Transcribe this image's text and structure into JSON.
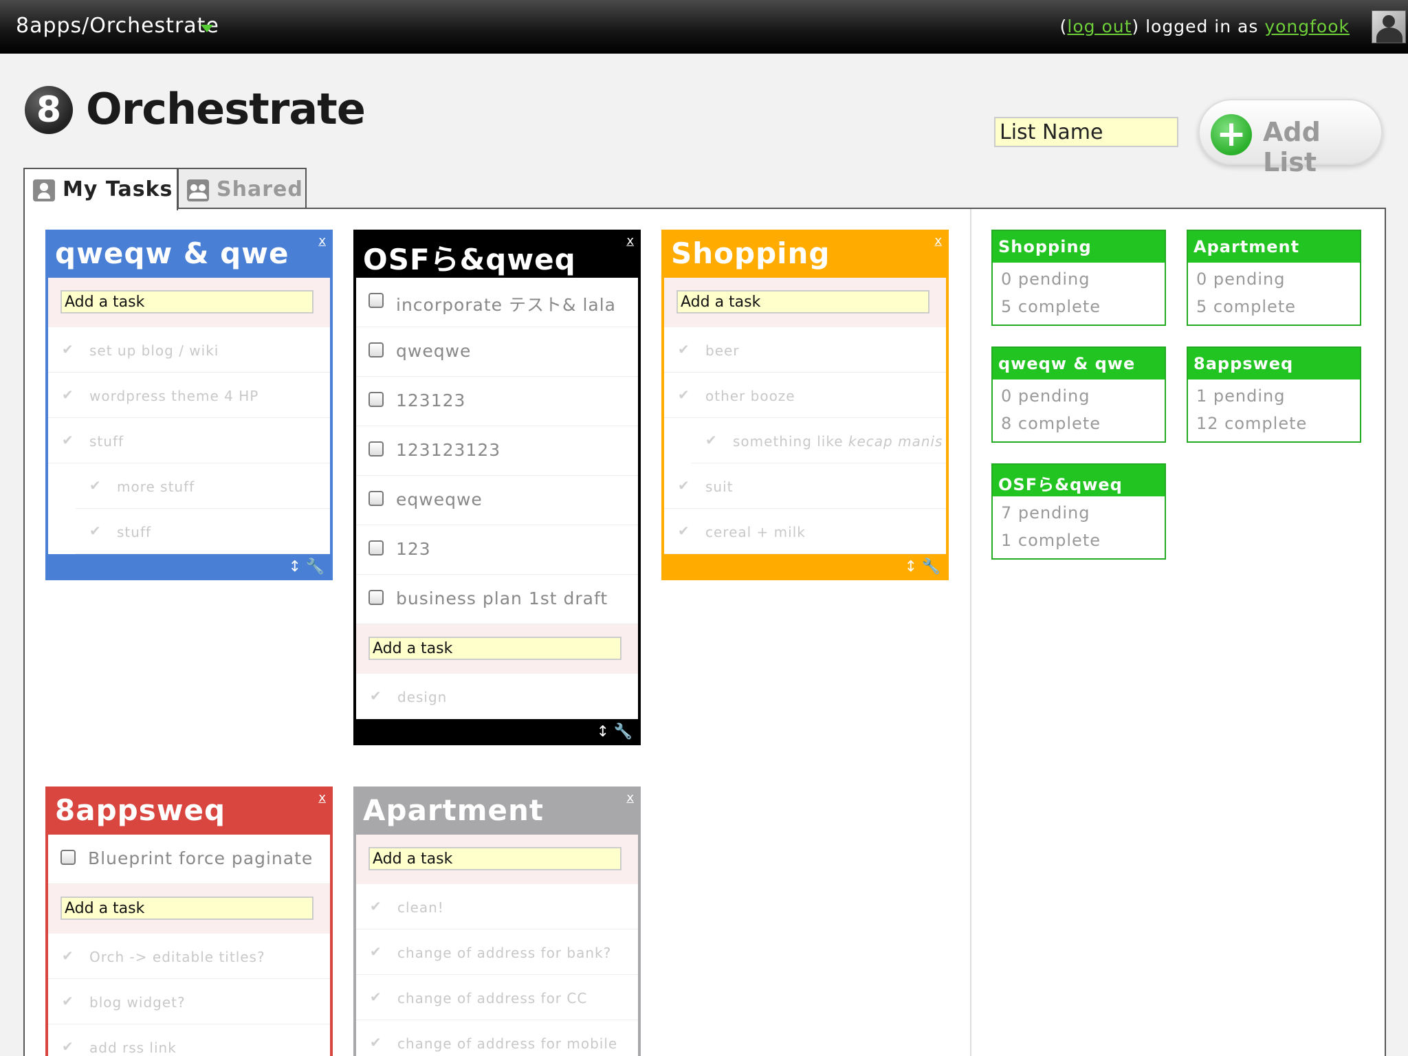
{
  "topbar": {
    "app_name": "8apps/Orchestrate",
    "paren_open": "(",
    "logout": "log out",
    "paren_close": ")",
    "logged_in_as": " logged in as ",
    "username": "yongfook"
  },
  "brand": {
    "logo_glyph": "8",
    "title": "Orchestrate"
  },
  "list_name_input": {
    "value": "List Name"
  },
  "add_list": {
    "plus": "+",
    "label": "Add List"
  },
  "tabs": [
    {
      "label": "My Tasks"
    },
    {
      "label": "Shared"
    }
  ],
  "cards": {
    "close_label": "x",
    "move_icon": "↕",
    "wrench_icon": "🔧",
    "add_task_placeholder": "Add a task",
    "check": "✔",
    "qweqw": {
      "title": "qweqw & qwe",
      "color": "#4a7fd6",
      "done": [
        "set up blog / wiki",
        "wordpress theme 4 HP",
        "stuff",
        "more stuff",
        "stuff"
      ]
    },
    "osf": {
      "title": "OSFら&qweq",
      "color": "#000000",
      "pending": [
        "incorporate テスト& lala",
        "qweqwe",
        "123123",
        "123123123",
        "eqweqwe",
        "123",
        "business plan 1st draft"
      ],
      "done": [
        "design"
      ]
    },
    "shopping": {
      "title": "Shopping",
      "color": "#ffab00",
      "done": [
        "beer",
        "other booze",
        "something like ",
        "suit",
        "cereal + milk"
      ],
      "done_italic": "kecap manis"
    },
    "appsweq": {
      "title": "8appsweq",
      "color": "#d9453f",
      "pending": [
        "Blueprint force paginate"
      ],
      "done": [
        "Orch -> editable titles?",
        "blog widget?",
        "add rss link"
      ]
    },
    "apartment": {
      "title": "Apartment",
      "color": "#a8a8aa",
      "done": [
        "clean!",
        "change of address for bank?",
        "change of address for CC",
        "change of address for mobile"
      ]
    }
  },
  "summaries": [
    {
      "title": "Shopping",
      "pending": "0 pending",
      "complete": "5 complete"
    },
    {
      "title": "Apartment",
      "pending": "0 pending",
      "complete": "5 complete"
    },
    {
      "title": "qweqw & qwe",
      "pending": "0 pending",
      "complete": "8 complete"
    },
    {
      "title": "8appsweq",
      "pending": "1 pending",
      "complete": "12 complete"
    },
    {
      "title": "OSFら&qweq",
      "pending": "7 pending",
      "complete": "1 complete"
    }
  ],
  "colors": {
    "summary_green": "#22c422",
    "link_green": "#6fcf3b",
    "input_yellow": "#ffffcc"
  }
}
